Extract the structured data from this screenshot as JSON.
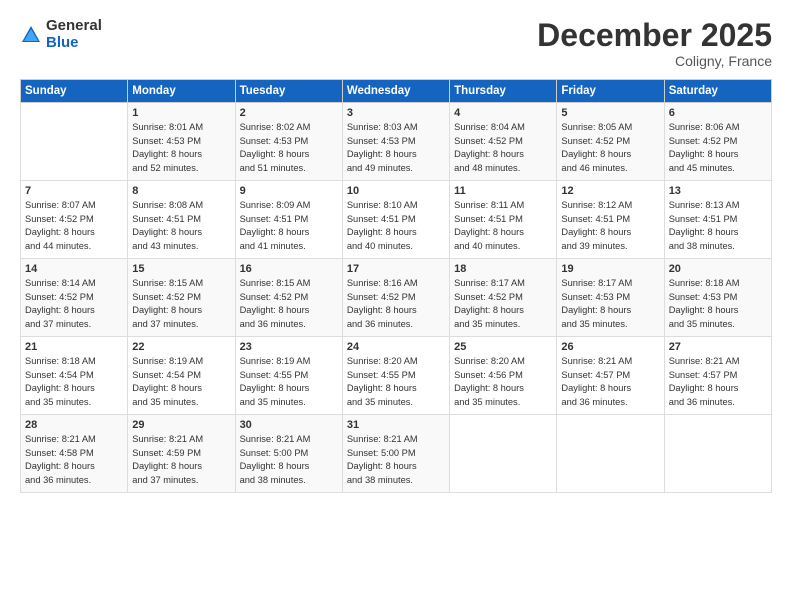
{
  "logo": {
    "general": "General",
    "blue": "Blue"
  },
  "title": "December 2025",
  "location": "Coligny, France",
  "headers": [
    "Sunday",
    "Monday",
    "Tuesday",
    "Wednesday",
    "Thursday",
    "Friday",
    "Saturday"
  ],
  "weeks": [
    [
      {
        "day": "",
        "info": ""
      },
      {
        "day": "1",
        "info": "Sunrise: 8:01 AM\nSunset: 4:53 PM\nDaylight: 8 hours\nand 52 minutes."
      },
      {
        "day": "2",
        "info": "Sunrise: 8:02 AM\nSunset: 4:53 PM\nDaylight: 8 hours\nand 51 minutes."
      },
      {
        "day": "3",
        "info": "Sunrise: 8:03 AM\nSunset: 4:53 PM\nDaylight: 8 hours\nand 49 minutes."
      },
      {
        "day": "4",
        "info": "Sunrise: 8:04 AM\nSunset: 4:52 PM\nDaylight: 8 hours\nand 48 minutes."
      },
      {
        "day": "5",
        "info": "Sunrise: 8:05 AM\nSunset: 4:52 PM\nDaylight: 8 hours\nand 46 minutes."
      },
      {
        "day": "6",
        "info": "Sunrise: 8:06 AM\nSunset: 4:52 PM\nDaylight: 8 hours\nand 45 minutes."
      }
    ],
    [
      {
        "day": "7",
        "info": "Sunrise: 8:07 AM\nSunset: 4:52 PM\nDaylight: 8 hours\nand 44 minutes."
      },
      {
        "day": "8",
        "info": "Sunrise: 8:08 AM\nSunset: 4:51 PM\nDaylight: 8 hours\nand 43 minutes."
      },
      {
        "day": "9",
        "info": "Sunrise: 8:09 AM\nSunset: 4:51 PM\nDaylight: 8 hours\nand 41 minutes."
      },
      {
        "day": "10",
        "info": "Sunrise: 8:10 AM\nSunset: 4:51 PM\nDaylight: 8 hours\nand 40 minutes."
      },
      {
        "day": "11",
        "info": "Sunrise: 8:11 AM\nSunset: 4:51 PM\nDaylight: 8 hours\nand 40 minutes."
      },
      {
        "day": "12",
        "info": "Sunrise: 8:12 AM\nSunset: 4:51 PM\nDaylight: 8 hours\nand 39 minutes."
      },
      {
        "day": "13",
        "info": "Sunrise: 8:13 AM\nSunset: 4:51 PM\nDaylight: 8 hours\nand 38 minutes."
      }
    ],
    [
      {
        "day": "14",
        "info": "Sunrise: 8:14 AM\nSunset: 4:52 PM\nDaylight: 8 hours\nand 37 minutes."
      },
      {
        "day": "15",
        "info": "Sunrise: 8:15 AM\nSunset: 4:52 PM\nDaylight: 8 hours\nand 37 minutes."
      },
      {
        "day": "16",
        "info": "Sunrise: 8:15 AM\nSunset: 4:52 PM\nDaylight: 8 hours\nand 36 minutes."
      },
      {
        "day": "17",
        "info": "Sunrise: 8:16 AM\nSunset: 4:52 PM\nDaylight: 8 hours\nand 36 minutes."
      },
      {
        "day": "18",
        "info": "Sunrise: 8:17 AM\nSunset: 4:52 PM\nDaylight: 8 hours\nand 35 minutes."
      },
      {
        "day": "19",
        "info": "Sunrise: 8:17 AM\nSunset: 4:53 PM\nDaylight: 8 hours\nand 35 minutes."
      },
      {
        "day": "20",
        "info": "Sunrise: 8:18 AM\nSunset: 4:53 PM\nDaylight: 8 hours\nand 35 minutes."
      }
    ],
    [
      {
        "day": "21",
        "info": "Sunrise: 8:18 AM\nSunset: 4:54 PM\nDaylight: 8 hours\nand 35 minutes."
      },
      {
        "day": "22",
        "info": "Sunrise: 8:19 AM\nSunset: 4:54 PM\nDaylight: 8 hours\nand 35 minutes."
      },
      {
        "day": "23",
        "info": "Sunrise: 8:19 AM\nSunset: 4:55 PM\nDaylight: 8 hours\nand 35 minutes."
      },
      {
        "day": "24",
        "info": "Sunrise: 8:20 AM\nSunset: 4:55 PM\nDaylight: 8 hours\nand 35 minutes."
      },
      {
        "day": "25",
        "info": "Sunrise: 8:20 AM\nSunset: 4:56 PM\nDaylight: 8 hours\nand 35 minutes."
      },
      {
        "day": "26",
        "info": "Sunrise: 8:21 AM\nSunset: 4:57 PM\nDaylight: 8 hours\nand 36 minutes."
      },
      {
        "day": "27",
        "info": "Sunrise: 8:21 AM\nSunset: 4:57 PM\nDaylight: 8 hours\nand 36 minutes."
      }
    ],
    [
      {
        "day": "28",
        "info": "Sunrise: 8:21 AM\nSunset: 4:58 PM\nDaylight: 8 hours\nand 36 minutes."
      },
      {
        "day": "29",
        "info": "Sunrise: 8:21 AM\nSunset: 4:59 PM\nDaylight: 8 hours\nand 37 minutes."
      },
      {
        "day": "30",
        "info": "Sunrise: 8:21 AM\nSunset: 5:00 PM\nDaylight: 8 hours\nand 38 minutes."
      },
      {
        "day": "31",
        "info": "Sunrise: 8:21 AM\nSunset: 5:00 PM\nDaylight: 8 hours\nand 38 minutes."
      },
      {
        "day": "",
        "info": ""
      },
      {
        "day": "",
        "info": ""
      },
      {
        "day": "",
        "info": ""
      }
    ]
  ]
}
